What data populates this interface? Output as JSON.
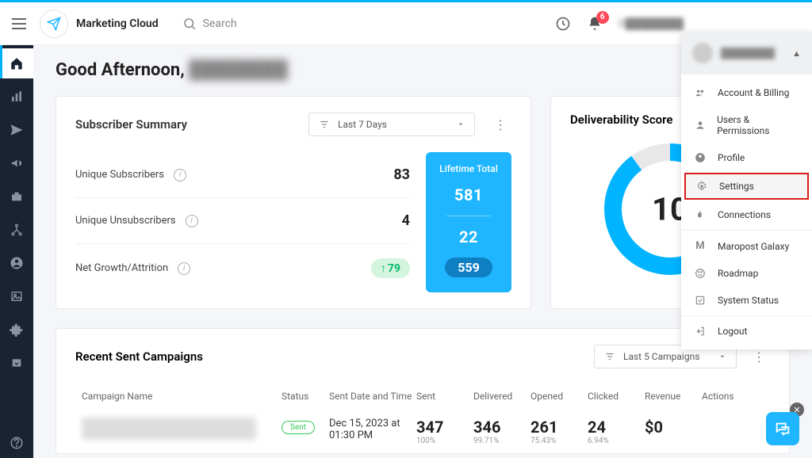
{
  "brand": {
    "name": "Marketing Cloud"
  },
  "search": {
    "placeholder": "Search"
  },
  "notifications": {
    "count": "6"
  },
  "header_user_text": "D████████",
  "greeting": {
    "prefix": "Good Afternoon, ",
    "name": "████████"
  },
  "subscriber_summary": {
    "title": "Subscriber Summary",
    "filter_label": "Last 7 Days",
    "rows": [
      {
        "label": "Unique Subscribers",
        "value": "83"
      },
      {
        "label": "Unique Unsubscribers",
        "value": "4"
      },
      {
        "label": "Net Growth/Attrition",
        "value": "79"
      }
    ],
    "lifetime": {
      "title": "Lifetime Total",
      "subscribers": "581",
      "unsubscribers": "22",
      "net": "559"
    }
  },
  "deliverability": {
    "title": "Deliverability Score",
    "score": "10"
  },
  "campaigns": {
    "title": "Recent Sent Campaigns",
    "filter_label": "Last 5 Campaigns",
    "columns": {
      "name": "Campaign Name",
      "status": "Status",
      "date": "Sent Date and Time",
      "sent": "Sent",
      "delivered": "Delivered",
      "opened": "Opened",
      "clicked": "Clicked",
      "revenue": "Revenue",
      "actions": "Actions"
    },
    "row1": {
      "status": "Sent",
      "date": "Dec 15, 2023 at 01:30 PM",
      "sent": "347",
      "sent_pct": "100%",
      "delivered": "346",
      "delivered_pct": "99.71%",
      "opened": "261",
      "opened_pct": "75.43%",
      "clicked": "24",
      "clicked_pct": "6.94%",
      "revenue": "$0"
    }
  },
  "user_menu": {
    "items": {
      "account": "Account & Billing",
      "users": "Users & Permissions",
      "profile": "Profile",
      "settings": "Settings",
      "connections": "Connections",
      "galaxy": "Maropost Galaxy",
      "roadmap": "Roadmap",
      "status": "System Status",
      "logout": "Logout"
    }
  }
}
